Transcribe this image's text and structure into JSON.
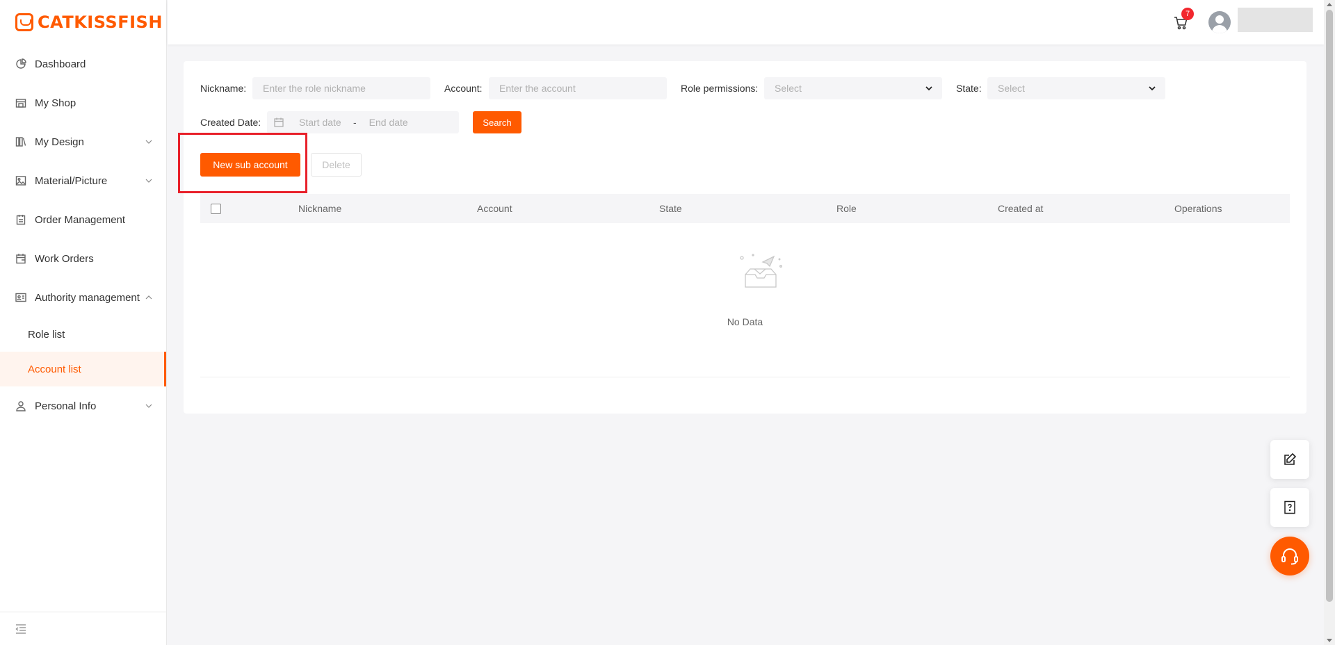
{
  "brand": {
    "name": "CATKISSFISH",
    "color": "#ff5a00"
  },
  "sidebar": {
    "items": [
      {
        "label": "Dashboard",
        "icon": "pie-chart-icon"
      },
      {
        "label": "My Shop",
        "icon": "shop-icon"
      },
      {
        "label": "My Design",
        "icon": "book-icon",
        "expandable": true
      },
      {
        "label": "Material/Picture",
        "icon": "image-icon",
        "expandable": true
      },
      {
        "label": "Order Management",
        "icon": "clipboard-icon"
      },
      {
        "label": "Work Orders",
        "icon": "calendar-icon"
      },
      {
        "label": "Authority management",
        "icon": "id-card-icon",
        "expanded": true
      },
      {
        "label": "Personal Info",
        "icon": "user-icon",
        "expandable": true
      }
    ],
    "sub_items": [
      {
        "label": "Role list",
        "active": false
      },
      {
        "label": "Account list",
        "active": true
      }
    ]
  },
  "header": {
    "cart_count": "7"
  },
  "filters": {
    "nickname_label": "Nickname:",
    "nickname_placeholder": "Enter the role nickname",
    "account_label": "Account:",
    "account_placeholder": "Enter the account",
    "role_label": "Role permissions:",
    "role_placeholder": "Select",
    "state_label": "State:",
    "state_placeholder": "Select",
    "created_label": "Created Date:",
    "start_placeholder": "Start date",
    "separator": "-",
    "end_placeholder": "End date",
    "search_label": "Search"
  },
  "actions": {
    "new_label": "New sub account",
    "delete_label": "Delete"
  },
  "table": {
    "columns": [
      "Nickname",
      "Account",
      "State",
      "Role",
      "Created at",
      "Operations"
    ],
    "empty_text": "No Data"
  }
}
